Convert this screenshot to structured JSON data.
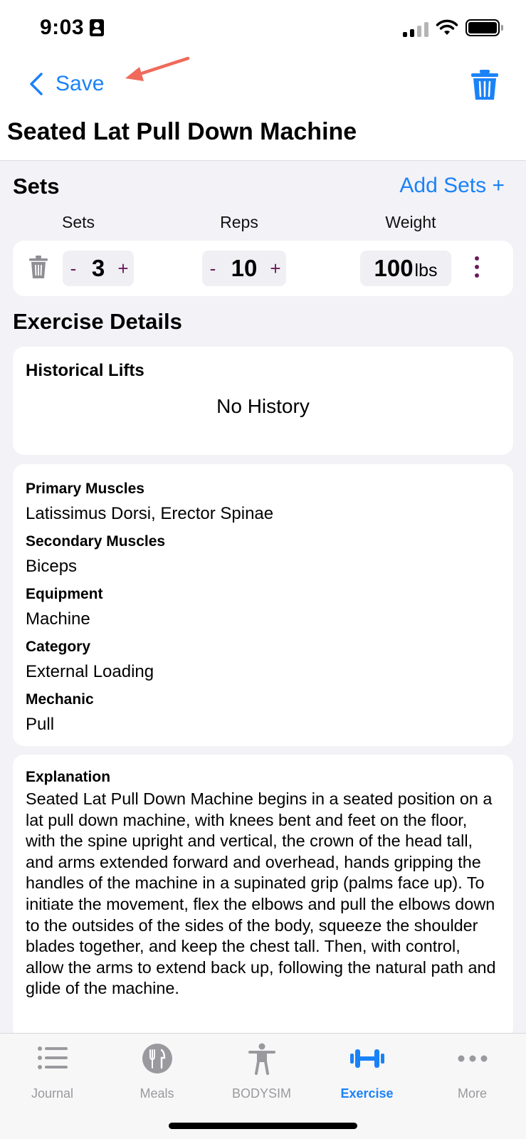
{
  "status_bar": {
    "time": "9:03"
  },
  "nav": {
    "back_label": "Save",
    "icons": [
      "chevron-left-icon",
      "trash-icon"
    ]
  },
  "page_title": "Seated Lat Pull Down Machine",
  "sets_section": {
    "title": "Sets",
    "add_label": "Add Sets +",
    "columns": [
      "Sets",
      "Reps",
      "Weight"
    ],
    "row": {
      "sets": "3",
      "reps": "10",
      "weight": "100",
      "weight_unit": "lbs",
      "minus_label": "-",
      "plus_label": "+"
    }
  },
  "details": {
    "title": "Exercise Details",
    "historical_lifts": {
      "label": "Historical Lifts",
      "empty_text": "No History"
    },
    "info": [
      {
        "label": "Primary Muscles",
        "value": "Latissimus Dorsi, Erector Spinae"
      },
      {
        "label": "Secondary Muscles",
        "value": "Biceps"
      },
      {
        "label": "Equipment",
        "value": "Machine"
      },
      {
        "label": "Category",
        "value": "External Loading"
      },
      {
        "label": "Mechanic",
        "value": "Pull"
      }
    ],
    "explanation": {
      "label": "Explanation",
      "text": "Seated Lat Pull Down Machine begins in a seated position on a lat pull down machine, with knees bent and feet on the floor, with the spine upright and vertical, the crown of the head tall, and arms extended forward and overhead, hands gripping the handles of the machine in a supinated grip (palms face up). To initiate the movement, flex the elbows and pull the elbows down to the outsides of the sides of the body, squeeze the shoulder blades together, and keep the chest tall. Then, with control, allow the arms to extend back up, following the natural path and glide of the machine."
    }
  },
  "tabs": [
    {
      "label": "Journal",
      "icon": "list-icon",
      "active": false
    },
    {
      "label": "Meals",
      "icon": "fork-knife-icon",
      "active": false
    },
    {
      "label": "BODYSIM",
      "icon": "body-icon",
      "active": false
    },
    {
      "label": "Exercise",
      "icon": "dumbbell-icon",
      "active": true
    },
    {
      "label": "More",
      "icon": "ellipsis-icon",
      "active": false
    }
  ],
  "colors": {
    "accent": "#1a82f7",
    "stepper_symbol": "#6a1b5a",
    "annotation_arrow": "#ef6a5a",
    "inactive_tab": "#9a9a9e"
  }
}
